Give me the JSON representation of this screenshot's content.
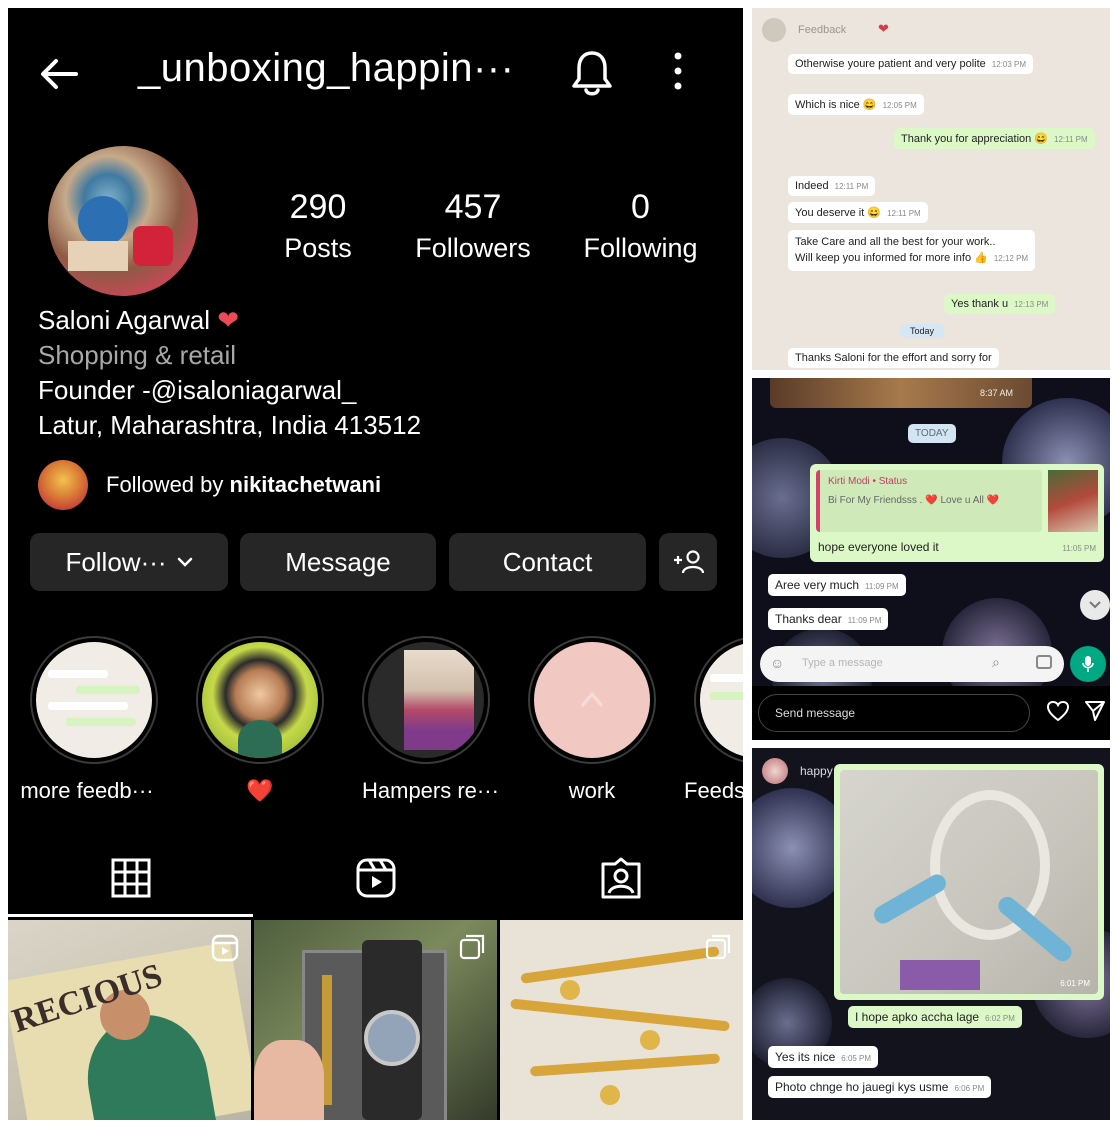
{
  "profile": {
    "username": "_unboxing_happin···",
    "stats": [
      {
        "value": "290",
        "label": "Posts"
      },
      {
        "value": "457",
        "label": "Followers"
      },
      {
        "value": "0",
        "label": "Following"
      }
    ],
    "name": "Saloni Agarwal",
    "category": "Shopping & retail",
    "bio_line1": "Founder -@isaloniagarwal_",
    "bio_line2": "Latur, Maharashtra, India 413512",
    "followed_by_prefix": "Followed by",
    "followed_by_user": "nikitachetwani"
  },
  "buttons": {
    "follow": "Follow···",
    "message": "Message",
    "contact": "Contact"
  },
  "highlights": [
    {
      "label": "more feedb···"
    },
    {
      "label": "❤️"
    },
    {
      "label": "Hampers re···"
    },
    {
      "label": "work"
    },
    {
      "label": "Feeds"
    }
  ],
  "chat1": {
    "title": "Feedback",
    "messages": [
      {
        "text": "Otherwise youre patient and very polite",
        "time": "12:03 PM"
      },
      {
        "text": "Which is nice 😄",
        "time": "12:05 PM"
      },
      {
        "text": "Thank you for appreciation 😄",
        "time": "12:11 PM"
      },
      {
        "text": "Indeed",
        "time": "12:11 PM"
      },
      {
        "text": "You deserve it 😄",
        "time": "12:11 PM"
      },
      {
        "text": "Take Care and all the best for your work..",
        "time": ""
      },
      {
        "text": "Will keep you informed for more info 👍",
        "time": "12:12 PM"
      },
      {
        "text": "Yes thank u",
        "time": "12:13 PM"
      },
      {
        "text": "Today",
        "time": ""
      },
      {
        "text": "Thanks Saloni for the effort and sorry for",
        "time": ""
      }
    ]
  },
  "chat2": {
    "top_time": "8:37 AM",
    "date_chip": "TODAY",
    "reply_sender": "Kirti Modi • Status",
    "reply_quote": "Bi For My Friendsss . ❤️ Love u All ❤️",
    "reply_text": "hope everyone loved it",
    "reply_time": "11:05 PM",
    "messages": [
      {
        "text": "Aree very much",
        "time": "11:09 PM"
      },
      {
        "text": "Thanks dear",
        "time": "11:09 PM"
      }
    ],
    "input_placeholder": "Type a message",
    "send_placeholder": "Send message"
  },
  "chat3": {
    "title": "happy customers",
    "photo_time": "6:01 PM",
    "messages": [
      {
        "text": "I hope apko accha lage",
        "time": "6:02 PM"
      },
      {
        "text": "Yes its nice",
        "time": "6:05 PM"
      },
      {
        "text": "Photo chnge ho jauegi kys usme",
        "time": "6:06 PM"
      }
    ]
  },
  "colors": {
    "background": "#000000",
    "button": "#262626",
    "heart": "#ed4956",
    "muted_text": "#a8a8a8",
    "chat_out": "#dcf8c6"
  }
}
